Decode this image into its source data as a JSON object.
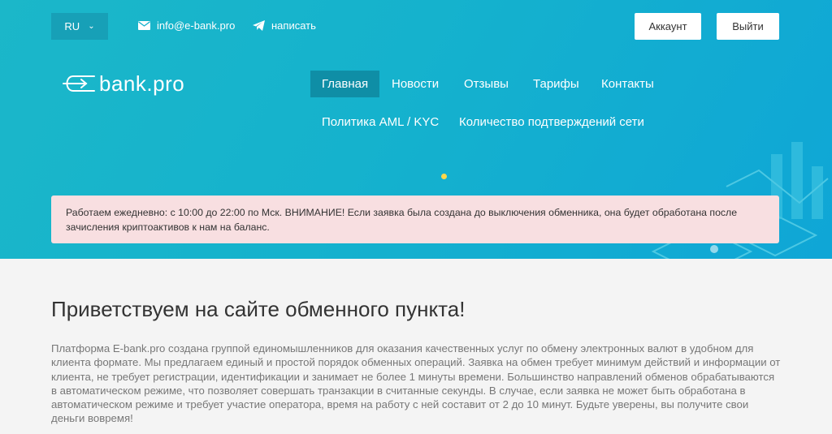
{
  "topbar": {
    "lang": "RU",
    "email": "info@e-bank.pro",
    "write": "написать",
    "account": "Аккаунт",
    "logout": "Выйти"
  },
  "logo": {
    "text": "bank.pro"
  },
  "nav": {
    "items": [
      "Главная",
      "Новости",
      "Отзывы",
      "Тарифы",
      "Контакты",
      "Политика AML / KYC",
      "Количество подтверждений сети"
    ],
    "active": "Главная"
  },
  "notice": "Работаем ежедневно: с 10:00 до 22:00 по Мск. ВНИМАНИЕ! Если заявка была создана до выключения обменника, она будет обработана после зачисления криптоактивов к нам на баланс.",
  "main": {
    "title": "Приветствуем на сайте обменного пункта!",
    "intro": "Платформа E-bank.pro создана группой единомышленников для оказания качественных услуг по обмену электронных валют в удобном для клиента формате. Мы предлагаем единый и простой порядок обменных операций. Заявка на обмен требует минимум действий и информации от клиента, не требует регистрации, идентификации и занимает не более 1 минуты времени. Большинство направлений обменов обрабатываются в автоматическом режиме, что позволяет совершать транзакции в считанные секунды. В случае, если заявка не может быть обработана в автоматическом режиме и требует участие оператора, время на работу с ней составит от 2 до 10 минут. Будьте уверены, вы получите свои деньги вовремя!"
  },
  "colors": {
    "hero": "#15b2cd",
    "active_nav": "#0f8ea6",
    "notice_bg": "#f8dfe1",
    "slider_dot": "#ffd84a"
  }
}
